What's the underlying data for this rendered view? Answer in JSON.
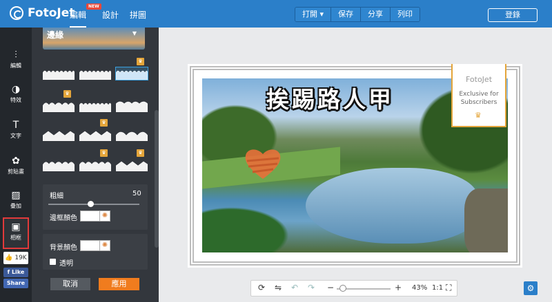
{
  "app": {
    "logo_text": "FotoJet",
    "nav": [
      "編輯",
      "設計",
      "拼圖"
    ],
    "new_badge": "NEW",
    "actions": [
      "打開 ▾",
      "保存",
      "分享",
      "列印"
    ],
    "login": "登錄"
  },
  "tools": [
    {
      "icon": "sliders-icon",
      "label": "編輯"
    },
    {
      "icon": "contrast-icon",
      "label": "特效"
    },
    {
      "icon": "text-icon",
      "label": "文字"
    },
    {
      "icon": "clipart-icon",
      "label": "剪貼畫"
    },
    {
      "icon": "overlay-icon",
      "label": "疊加"
    },
    {
      "icon": "frame-icon",
      "label": "相框"
    }
  ],
  "social": {
    "like_count": "19K",
    "like": "Like",
    "share": "Share"
  },
  "panel": {
    "dropdown_label": "邊緣",
    "thickness_label": "粗細",
    "thickness_value": "50",
    "thickness_level": 0.5,
    "border_color_label": "邊框顏色",
    "bg_color_label": "背景顏色",
    "transparent_label": "透明",
    "cancel": "取消",
    "apply": "應用"
  },
  "canvas": {
    "headline": "挨踢路人甲",
    "ribbon_logo": "FotoJet",
    "ribbon_text_1": "Exclusive for",
    "ribbon_text_2": "Subscribers"
  },
  "bottom": {
    "zoom": "43%"
  },
  "colors": {
    "topbar": "#2b7fc9",
    "accent": "#f07c1e",
    "premium": "#e4a53a"
  }
}
